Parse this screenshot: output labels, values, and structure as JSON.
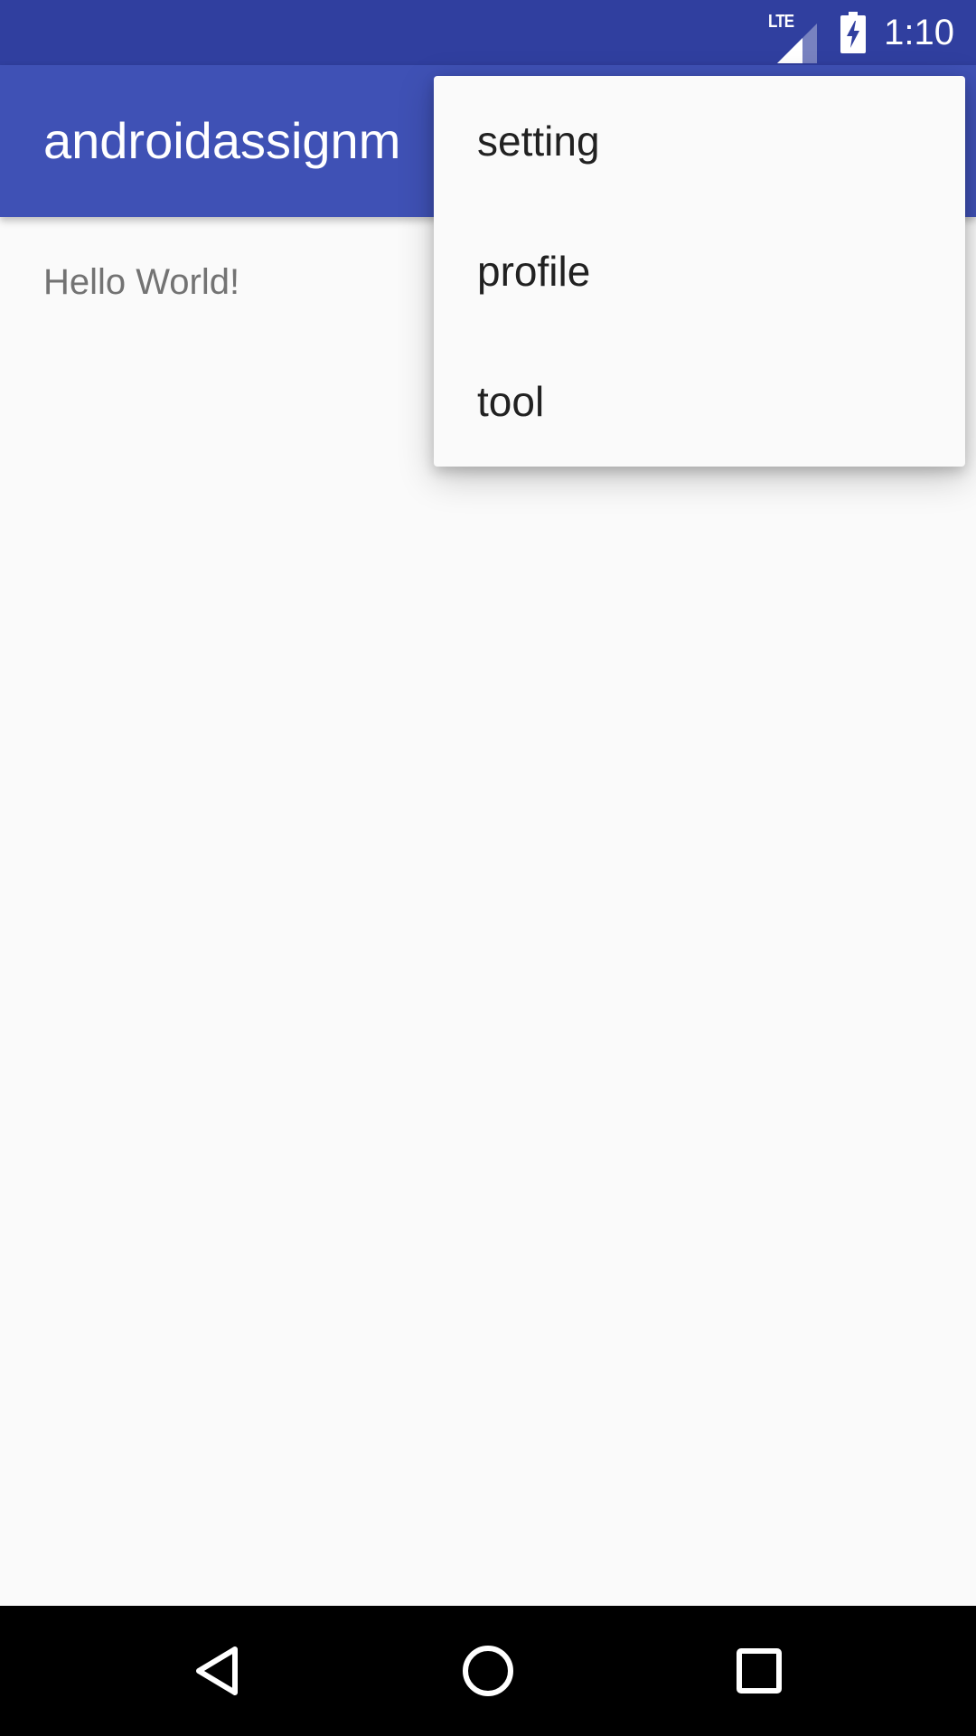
{
  "status_bar": {
    "network_label": "LTE",
    "signal_icon": "signal-icon",
    "battery_icon": "battery-charging-icon",
    "time": "1:10",
    "background_color": "#303f9f"
  },
  "app_bar": {
    "title": "androidassignm",
    "background_color": "#3f51b5"
  },
  "content": {
    "text": "Hello World!"
  },
  "overflow_menu": {
    "items": [
      {
        "label": "setting"
      },
      {
        "label": "profile"
      },
      {
        "label": "tool"
      }
    ]
  },
  "nav_bar": {
    "back_icon": "back-triangle-icon",
    "home_icon": "home-circle-icon",
    "recents_icon": "recents-square-icon"
  }
}
